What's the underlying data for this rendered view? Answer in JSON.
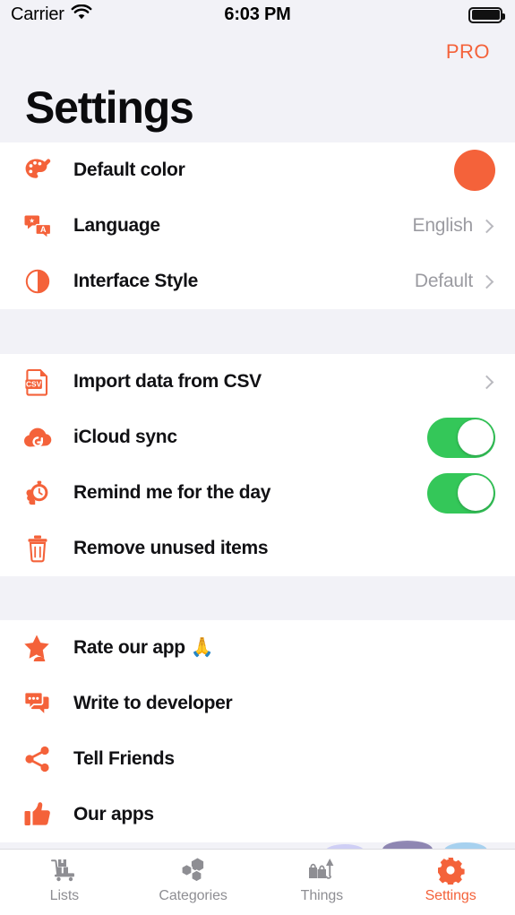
{
  "status_bar": {
    "carrier": "Carrier",
    "wifi_icon": "wifi-icon",
    "time": "6:03 PM",
    "battery_icon": "battery-icon"
  },
  "header": {
    "pro_label": "PRO",
    "title": "Settings"
  },
  "theme": {
    "accent": "#f4623a",
    "toggle_on": "#34c759",
    "background": "#f2f2f7",
    "card": "#ffffff",
    "value_text": "#9b9ba1"
  },
  "sections": [
    {
      "rows": [
        {
          "icon": "palette-icon",
          "label": "Default color",
          "accessory": "color-swatch",
          "swatch_color": "#f4623a"
        },
        {
          "icon": "translate-icon",
          "label": "Language",
          "accessory": "value-chevron",
          "value": "English"
        },
        {
          "icon": "interface-style-icon",
          "label": "Interface Style",
          "accessory": "value-chevron",
          "value": "Default"
        }
      ]
    },
    {
      "rows": [
        {
          "icon": "csv-file-icon",
          "label": "Import data from CSV",
          "accessory": "chevron"
        },
        {
          "icon": "icloud-icon",
          "label": "iCloud sync",
          "accessory": "toggle",
          "toggle_on": true
        },
        {
          "icon": "stopwatch-hand-icon",
          "label": "Remind me for the day",
          "accessory": "toggle",
          "toggle_on": true
        },
        {
          "icon": "trash-icon",
          "label": "Remove unused items",
          "accessory": "none"
        }
      ]
    },
    {
      "rows": [
        {
          "icon": "star-person-icon",
          "label": "Rate our app",
          "emoji": "🙏",
          "accessory": "none"
        },
        {
          "icon": "chat-bubbles-icon",
          "label": "Write to developer",
          "accessory": "none"
        },
        {
          "icon": "share-icon",
          "label": "Tell Friends",
          "accessory": "none"
        },
        {
          "icon": "thumbs-up-icon",
          "label": "Our apps",
          "accessory": "none"
        }
      ]
    }
  ],
  "tab_bar": {
    "tabs": [
      {
        "icon": "shopping-cart-icon",
        "label": "Lists",
        "active": false
      },
      {
        "icon": "hexagons-icon",
        "label": "Categories",
        "active": false
      },
      {
        "icon": "bags-umbrella-icon",
        "label": "Things",
        "active": false
      },
      {
        "icon": "gear-icon",
        "label": "Settings",
        "active": true
      }
    ]
  }
}
